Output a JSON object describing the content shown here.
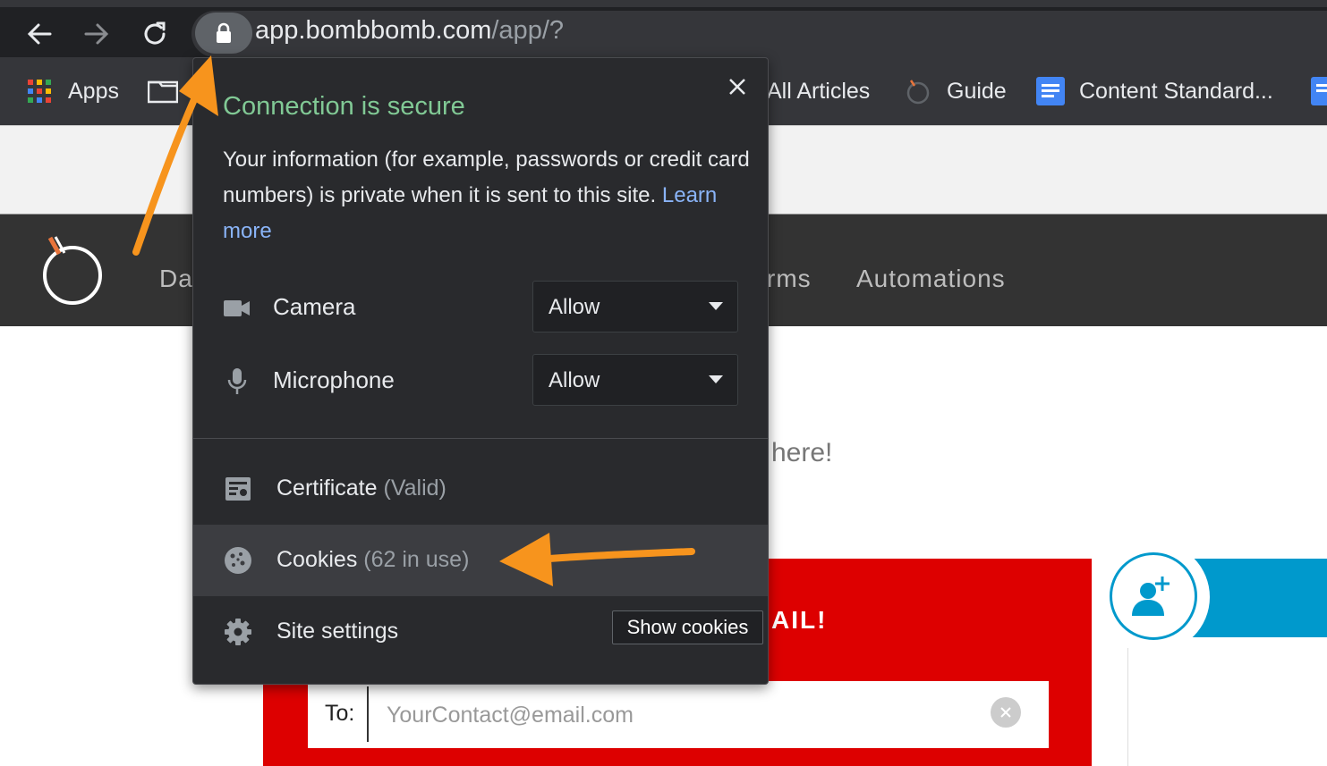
{
  "browser": {
    "url_host": "app.bombbomb.com",
    "url_path": "/app/?",
    "bookmarks": [
      {
        "label": "Apps",
        "icon": "apps-grid-icon"
      },
      {
        "label": "All Articles",
        "icon": ""
      },
      {
        "label": "Guide",
        "icon": "bombbomb-logo-icon"
      },
      {
        "label": "Content Standard...",
        "icon": "google-docs-icon"
      }
    ]
  },
  "page": {
    "nav_items": [
      "Da",
      "rms",
      "Automations"
    ],
    "hero_fragment": "here!",
    "red_panel_title_fragment": "AIL!",
    "to_label": "To:",
    "to_placeholder": "YourContact@email.com"
  },
  "popup": {
    "title": "Connection is secure",
    "description": "Your information (for example, passwords or credit card numbers) is private when it is sent to this site.",
    "learn_more": "Learn more",
    "permissions": [
      {
        "label": "Camera",
        "value": "Allow",
        "icon": "camera-icon"
      },
      {
        "label": "Microphone",
        "value": "Allow",
        "icon": "microphone-icon"
      }
    ],
    "menu": [
      {
        "label": "Certificate",
        "detail": "(Valid)",
        "icon": "certificate-icon"
      },
      {
        "label": "Cookies",
        "detail": "(62 in use)",
        "icon": "cookie-icon"
      },
      {
        "label": "Site settings",
        "detail": "",
        "icon": "gear-icon"
      }
    ],
    "tooltip": "Show cookies"
  },
  "colors": {
    "title_green": "#81c995",
    "link_blue": "#8ab4f8",
    "annotation_orange": "#f7941d",
    "brand_red": "#dd0000",
    "brand_blue": "#0099cc"
  }
}
